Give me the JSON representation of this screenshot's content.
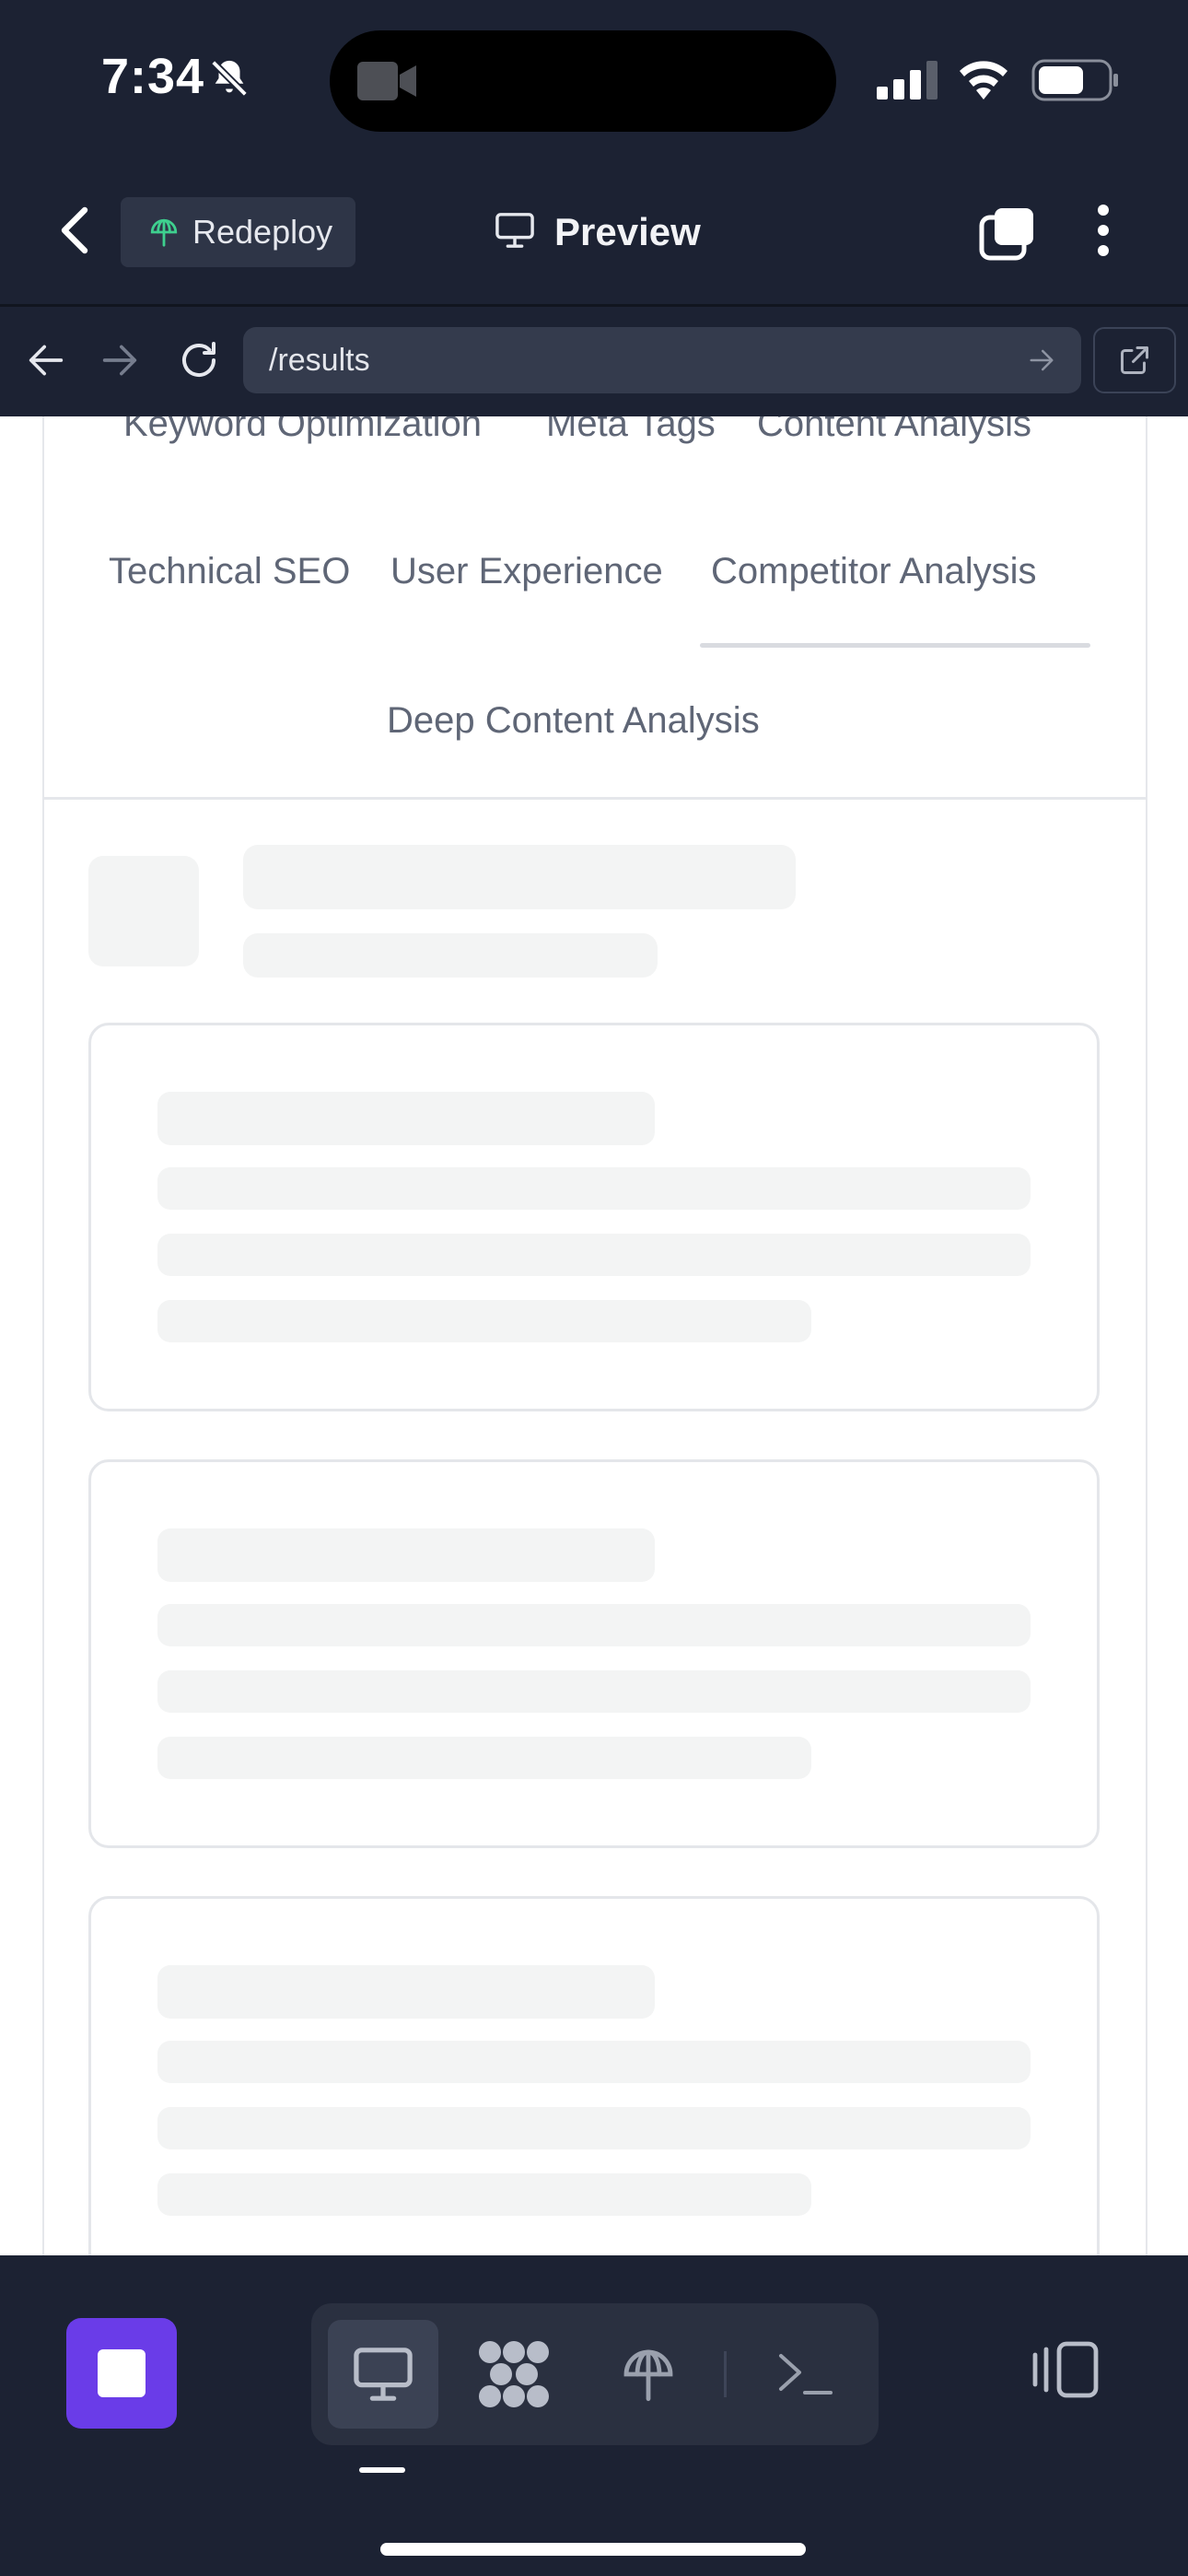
{
  "status_bar": {
    "time": "7:34",
    "icons": [
      "bell-slash-icon",
      "camera-icon",
      "cellular-signal-icon",
      "wifi-icon",
      "battery-icon"
    ]
  },
  "toolbar": {
    "redeploy_label": "Redeploy",
    "preview_label": "Preview",
    "icons": [
      "chevron-left-icon",
      "deploy-icon",
      "monitor-icon",
      "tabs-icon",
      "more-vertical-icon"
    ]
  },
  "url_bar": {
    "url": "/results",
    "icons": [
      "arrow-left-icon",
      "arrow-right-icon",
      "reload-icon",
      "go-arrow-icon",
      "external-link-icon"
    ]
  },
  "tabs": [
    {
      "label": "Keyword Optimization"
    },
    {
      "label": "Meta Tags"
    },
    {
      "label": "Content Analysis"
    },
    {
      "label": "Technical SEO"
    },
    {
      "label": "User Experience"
    },
    {
      "label": "Competitor Analysis",
      "active": true
    },
    {
      "label": "Deep Content Analysis"
    }
  ],
  "bottom_bar": {
    "tools": [
      "monitor-icon",
      "apps-grid-icon",
      "deploy-icon",
      "terminal-icon"
    ],
    "active_tool": "monitor-icon",
    "panel_icon": "panel-toggle-icon"
  },
  "colors": {
    "chrome_bg": "#1c2233",
    "accent": "#6a3ce8",
    "skeleton": "#f3f4f4",
    "tab_text": "#5f6676"
  }
}
